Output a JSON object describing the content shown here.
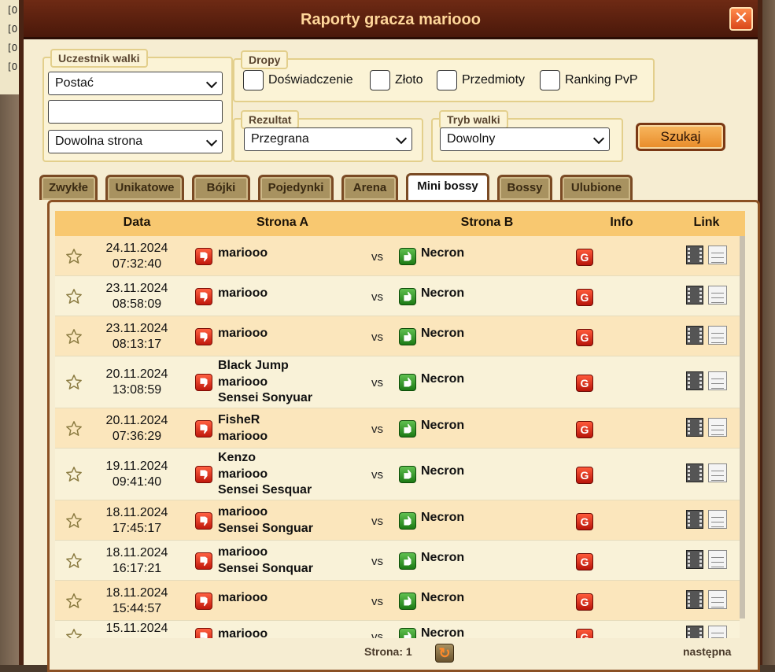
{
  "background": {
    "left_marks": [
      "[0",
      "[0",
      "[0",
      "[0"
    ]
  },
  "window": {
    "title": "Raporty gracza mariooo",
    "close_icon": "close-icon"
  },
  "filters": {
    "participant": {
      "legend": "Uczestnik walki",
      "type_select": "Postać",
      "name_value": "",
      "side_select": "Dowolna strona"
    },
    "drops": {
      "legend": "Dropy",
      "options": [
        "Doświadczenie",
        "Złoto",
        "Przedmioty",
        "Ranking PvP"
      ]
    },
    "result": {
      "legend": "Rezultat",
      "selected": "Przegrana"
    },
    "mode": {
      "legend": "Tryb walki",
      "selected": "Dowolny"
    },
    "search_label": "Szukaj"
  },
  "tabs": [
    {
      "label": "Zwykłe",
      "active": false
    },
    {
      "label": "Unikatowe",
      "active": false
    },
    {
      "label": "Bójki",
      "active": false
    },
    {
      "label": "Pojedynki",
      "active": false
    },
    {
      "label": "Arena",
      "active": false
    },
    {
      "label": "Mini bossy",
      "active": true
    },
    {
      "label": "Bossy",
      "active": false
    },
    {
      "label": "Ulubione",
      "active": false
    }
  ],
  "table": {
    "headers": {
      "date": "Data",
      "side_a": "Strona A",
      "side_b": "Strona B",
      "info": "Info",
      "link": "Link"
    },
    "vs_label": "vs",
    "info_badge": "G",
    "rows": [
      {
        "date": "24.11.2024",
        "time": "07:32:40",
        "side_a": [
          "mariooo"
        ],
        "side_b": "Necron"
      },
      {
        "date": "23.11.2024",
        "time": "08:58:09",
        "side_a": [
          "mariooo"
        ],
        "side_b": "Necron"
      },
      {
        "date": "23.11.2024",
        "time": "08:13:17",
        "side_a": [
          "mariooo"
        ],
        "side_b": "Necron"
      },
      {
        "date": "20.11.2024",
        "time": "13:08:59",
        "side_a": [
          "Black Jump",
          "mariooo",
          "Sensei Sonyuar"
        ],
        "side_b": "Necron"
      },
      {
        "date": "20.11.2024",
        "time": "07:36:29",
        "side_a": [
          "FisheR",
          "mariooo"
        ],
        "side_b": "Necron"
      },
      {
        "date": "19.11.2024",
        "time": "09:41:40",
        "side_a": [
          "Kenzo",
          "mariooo",
          "Sensei Sesquar"
        ],
        "side_b": "Necron"
      },
      {
        "date": "18.11.2024",
        "time": "17:45:17",
        "side_a": [
          "mariooo",
          "Sensei Songuar"
        ],
        "side_b": "Necron"
      },
      {
        "date": "18.11.2024",
        "time": "16:17:21",
        "side_a": [
          "mariooo",
          "Sensei Sonquar"
        ],
        "side_b": "Necron"
      },
      {
        "date": "18.11.2024",
        "time": "15:44:57",
        "side_a": [
          "mariooo"
        ],
        "side_b": "Necron"
      },
      {
        "date": "15.11.2024",
        "time": "",
        "side_a": [
          "mariooo"
        ],
        "side_b": "Necron"
      }
    ]
  },
  "pagination": {
    "page_label": "Strona: 1",
    "next_label": "następna"
  }
}
